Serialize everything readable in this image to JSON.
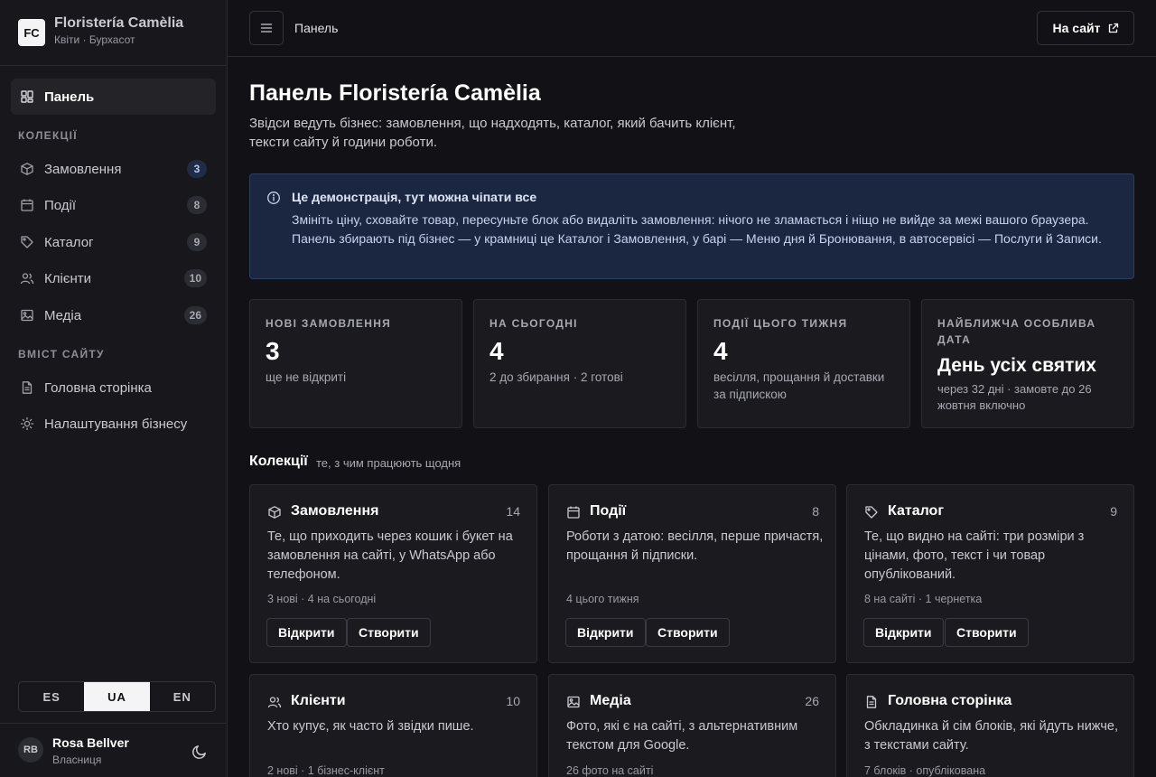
{
  "brand": {
    "logo": "FC",
    "name": "Floristería Camèlia",
    "subtitle": "Квіти · Бурхасот"
  },
  "sidebar": {
    "dashboard": {
      "label": "Панель",
      "icon": "dashboard-icon"
    },
    "collections_label": "КОЛЕКЦІЇ",
    "collections": [
      {
        "label": "Замовлення",
        "count": "3",
        "icon": "box-icon"
      },
      {
        "label": "Події",
        "count": "8",
        "icon": "calendar-icon"
      },
      {
        "label": "Каталог",
        "count": "9",
        "icon": "tag-icon"
      },
      {
        "label": "Клієнти",
        "count": "10",
        "icon": "users-icon"
      },
      {
        "label": "Медіа",
        "count": "26",
        "icon": "image-icon"
      }
    ],
    "content_label": "ВМІСТ САЙТУ",
    "content": [
      {
        "label": "Головна сторінка",
        "icon": "document-icon"
      },
      {
        "label": "Налаштування бізнесу",
        "icon": "sun-icon"
      }
    ],
    "languages": [
      "ES",
      "UA",
      "EN"
    ],
    "selected_language": "UA",
    "user": {
      "initials": "RB",
      "name": "Rosa Bellver",
      "role": "Власниця"
    }
  },
  "topbar": {
    "breadcrumb": "Панель",
    "site_button": "На сайт"
  },
  "page": {
    "title": "Панель Floristería Camèlia",
    "description": "Звідси ведуть бізнес: замовлення, що надходять, каталог, який бачить клієнт, тексти сайту й години роботи."
  },
  "alert": {
    "title": "Це демонстрація, тут можна чіпати все",
    "text": "Змініть ціну, сховайте товар, пересуньте блок або видаліть замовлення: нічого не зламається і ніщо не вийде за межі вашого браузера. Панель збирають під бізнес — у крамниці це Каталог і Замовлення, у барі — Меню дня й Бронювання, в автосервісі — Послуги й Записи."
  },
  "stats": [
    {
      "label": "НОВІ ЗАМОВЛЕННЯ",
      "value": "3",
      "sub": "ще не відкриті"
    },
    {
      "label": "НА СЬОГОДНІ",
      "value": "4",
      "sub": "2 до збирання · 2 готові"
    },
    {
      "label": "ПОДІЇ ЦЬОГО ТИЖНЯ",
      "value": "4",
      "sub": "весілля, прощання й доставки за підпискою"
    },
    {
      "label": "НАЙБЛИЖЧА ОСОБЛИВА ДАТА",
      "value": "День усіх святих",
      "sub": "через 32 дні · замовте до 26 жовтня включно"
    }
  ],
  "collections_section": {
    "title": "Колекції",
    "subtitle": "те, з чим працюють щодня"
  },
  "cards": [
    {
      "title": "Замовлення",
      "count": "14",
      "icon": "box-icon",
      "desc": "Те, що приходить через кошик і букет на замовлення на сайті, у WhatsApp або телефоном.",
      "meta": "3 нові · 4 на сьогодні",
      "open": "Відкрити",
      "create": "Створити"
    },
    {
      "title": "Події",
      "count": "8",
      "icon": "calendar-icon",
      "desc": "Роботи з датою: весілля, перше причастя, прощання й підписки.",
      "meta": "4 цього тижня",
      "open": "Відкрити",
      "create": "Створити"
    },
    {
      "title": "Каталог",
      "count": "9",
      "icon": "tag-icon",
      "desc": "Те, що видно на сайті: три розміри з цінами, фото, текст і чи товар опублікований.",
      "meta": "8 на сайті · 1 чернетка",
      "open": "Відкрити",
      "create": "Створити"
    },
    {
      "title": "Клієнти",
      "count": "10",
      "icon": "users-icon",
      "desc": "Хто купує, як часто й звідки пише.",
      "meta": "2 нові · 1 бізнес-клієнт"
    },
    {
      "title": "Медіа",
      "count": "26",
      "icon": "image-icon",
      "desc": "Фото, які є на сайті, з альтернативним текстом для Google.",
      "meta": "26 фото на сайті"
    },
    {
      "title": "Головна сторінка",
      "count": "",
      "icon": "document-icon",
      "desc": "Обкладинка й сім блоків, які йдуть нижче, з текстами сайту.",
      "meta": "7 блоків · опублікована"
    }
  ]
}
